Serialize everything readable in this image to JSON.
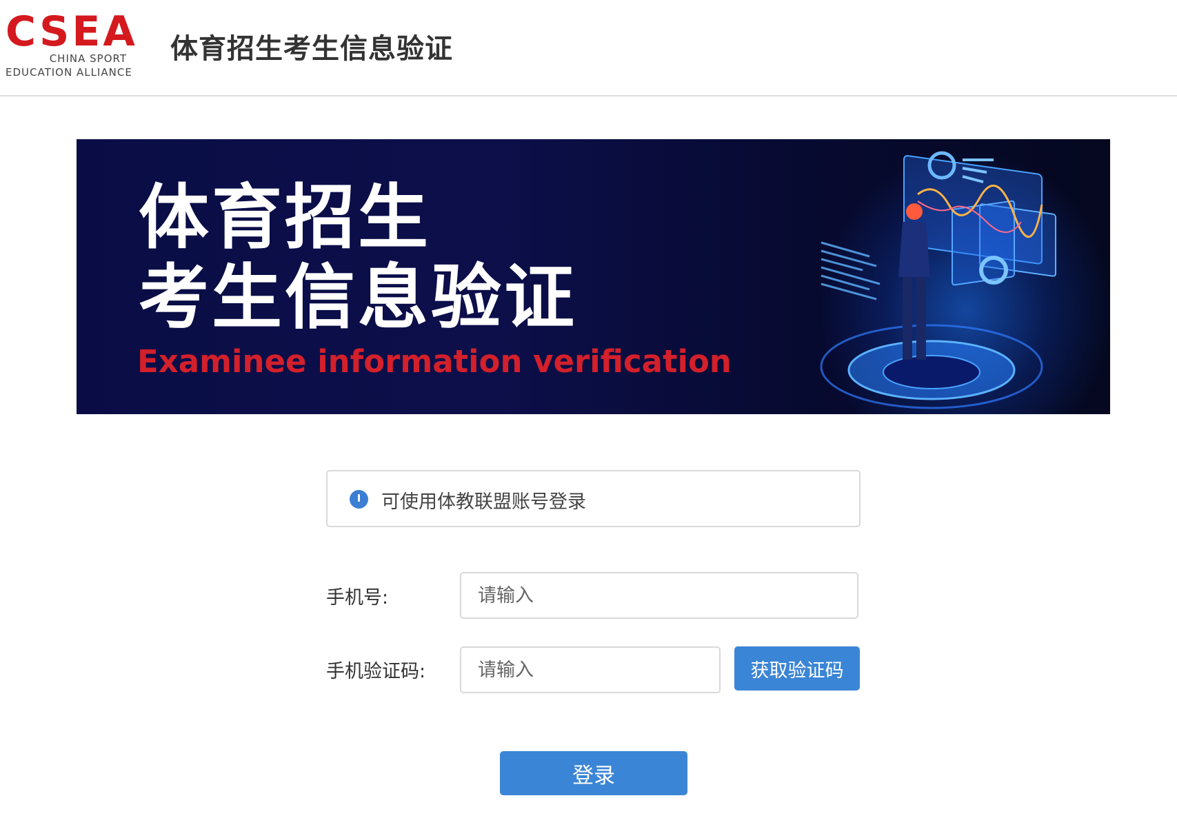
{
  "header": {
    "logo": {
      "mark": "CSEA",
      "line1": "CHINA  SPORT",
      "line2": "EDUCATION  ALLIANCE",
      "color": "#d4191f"
    },
    "title": "体育招生考生信息验证"
  },
  "banner": {
    "line1": "体育招生",
    "line2": "考生信息验证",
    "subtitle_en": "Examinee information verification",
    "subtitle_color": "#d3202b"
  },
  "notice": {
    "icon": "info-icon",
    "text": "可使用体教联盟账号登录"
  },
  "form": {
    "phone_label": "手机号:",
    "phone_placeholder": "请输入",
    "code_label": "手机验证码:",
    "code_placeholder": "请输入",
    "get_code_button": "获取验证码",
    "login_button": "登录",
    "accent_color": "#3b85d6"
  }
}
